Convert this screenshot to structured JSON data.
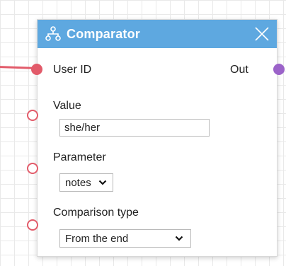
{
  "node": {
    "title": "Comparator",
    "icon": "hierarchy-icon",
    "close_icon": "close-icon"
  },
  "ports": {
    "user_id_label": "User ID",
    "out_label": "Out"
  },
  "fields": {
    "value": {
      "label": "Value",
      "input_value": "she/her"
    },
    "parameter": {
      "label": "Parameter",
      "selected": "notes"
    },
    "comparison_type": {
      "label": "Comparison type",
      "selected": "From the end"
    }
  },
  "colors": {
    "header": "#5ea8e0",
    "input_port": "#e25b6a",
    "output_port": "#9b63c9"
  }
}
